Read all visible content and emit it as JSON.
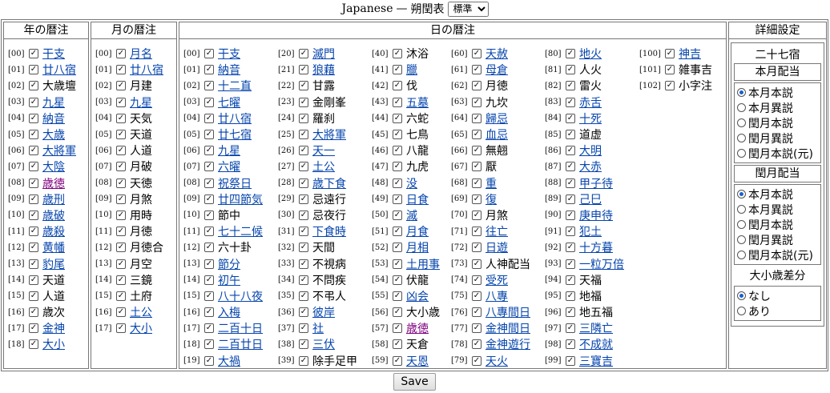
{
  "header": {
    "lang": "Japanese",
    "dash": "—",
    "title": "朔閏表",
    "select_value": "標準"
  },
  "columns": {
    "year": "年の暦注",
    "month": "月の暦注",
    "day": "日の暦注",
    "settings": "詳細設定"
  },
  "year_items": [
    {
      "idx": "[00]",
      "label": "干支",
      "link": true
    },
    {
      "idx": "[01]",
      "label": "廿八宿",
      "link": true
    },
    {
      "idx": "[02]",
      "label": "大歳壇",
      "link": false
    },
    {
      "idx": "[03]",
      "label": "九星",
      "link": true
    },
    {
      "idx": "[04]",
      "label": "納音",
      "link": true
    },
    {
      "idx": "[05]",
      "label": "大歳",
      "link": true
    },
    {
      "idx": "[06]",
      "label": "大將軍",
      "link": true
    },
    {
      "idx": "[07]",
      "label": "大陰",
      "link": true
    },
    {
      "idx": "[08]",
      "label": "歳徳",
      "link": true,
      "visited": true
    },
    {
      "idx": "[09]",
      "label": "歳刑",
      "link": true
    },
    {
      "idx": "[10]",
      "label": "歳破",
      "link": true
    },
    {
      "idx": "[11]",
      "label": "歳殺",
      "link": true
    },
    {
      "idx": "[12]",
      "label": "黄幡",
      "link": true
    },
    {
      "idx": "[13]",
      "label": "豹尾",
      "link": true
    },
    {
      "idx": "[14]",
      "label": "天道",
      "link": false
    },
    {
      "idx": "[15]",
      "label": "人道",
      "link": false
    },
    {
      "idx": "[16]",
      "label": "歳次",
      "link": false
    },
    {
      "idx": "[17]",
      "label": "金神",
      "link": true
    },
    {
      "idx": "[18]",
      "label": "大小",
      "link": true
    }
  ],
  "month_items": [
    {
      "idx": "[00]",
      "label": "月名",
      "link": true
    },
    {
      "idx": "[01]",
      "label": "廿八宿",
      "link": true
    },
    {
      "idx": "[02]",
      "label": "月建",
      "link": false
    },
    {
      "idx": "[03]",
      "label": "九星",
      "link": true
    },
    {
      "idx": "[04]",
      "label": "天気",
      "link": false
    },
    {
      "idx": "[05]",
      "label": "天道",
      "link": false
    },
    {
      "idx": "[06]",
      "label": "人道",
      "link": false
    },
    {
      "idx": "[07]",
      "label": "月破",
      "link": false
    },
    {
      "idx": "[08]",
      "label": "天徳",
      "link": false
    },
    {
      "idx": "[09]",
      "label": "月煞",
      "link": false
    },
    {
      "idx": "[10]",
      "label": "用時",
      "link": false
    },
    {
      "idx": "[11]",
      "label": "月徳",
      "link": false
    },
    {
      "idx": "[12]",
      "label": "月徳合",
      "link": false
    },
    {
      "idx": "[13]",
      "label": "月空",
      "link": false
    },
    {
      "idx": "[14]",
      "label": "三鏡",
      "link": false
    },
    {
      "idx": "[15]",
      "label": "土府",
      "link": false
    },
    {
      "idx": "[16]",
      "label": "土公",
      "link": true
    },
    {
      "idx": "[17]",
      "label": "大小",
      "link": true
    }
  ],
  "day_columns": [
    [
      {
        "idx": "[00]",
        "label": "干支",
        "link": true
      },
      {
        "idx": "[01]",
        "label": "納音",
        "link": true
      },
      {
        "idx": "[02]",
        "label": "十二直",
        "link": true
      },
      {
        "idx": "[03]",
        "label": "七曜",
        "link": true
      },
      {
        "idx": "[04]",
        "label": "廿八宿",
        "link": true
      },
      {
        "idx": "[05]",
        "label": "廿七宿",
        "link": true
      },
      {
        "idx": "[06]",
        "label": "九星",
        "link": true
      },
      {
        "idx": "[07]",
        "label": "六曜",
        "link": true
      },
      {
        "idx": "[08]",
        "label": "祝祭日",
        "link": true
      },
      {
        "idx": "[09]",
        "label": "廿四節気",
        "link": true
      },
      {
        "idx": "[10]",
        "label": "節中",
        "link": false
      },
      {
        "idx": "[11]",
        "label": "七十二候",
        "link": true
      },
      {
        "idx": "[12]",
        "label": "六十卦",
        "link": false
      },
      {
        "idx": "[13]",
        "label": "節分",
        "link": true
      },
      {
        "idx": "[14]",
        "label": "初午",
        "link": true
      },
      {
        "idx": "[15]",
        "label": "八十八夜",
        "link": true
      },
      {
        "idx": "[16]",
        "label": "入梅",
        "link": true
      },
      {
        "idx": "[17]",
        "label": "二百十日",
        "link": true
      },
      {
        "idx": "[18]",
        "label": "二百廿日",
        "link": true
      },
      {
        "idx": "[19]",
        "label": "大禍",
        "link": true
      }
    ],
    [
      {
        "idx": "[20]",
        "label": "滅門",
        "link": true
      },
      {
        "idx": "[21]",
        "label": "狼藉",
        "link": true
      },
      {
        "idx": "[22]",
        "label": "甘露",
        "link": false
      },
      {
        "idx": "[23]",
        "label": "金剛峯",
        "link": false
      },
      {
        "idx": "[24]",
        "label": "羅刹",
        "link": false
      },
      {
        "idx": "[25]",
        "label": "大將軍",
        "link": true
      },
      {
        "idx": "[26]",
        "label": "天一",
        "link": true
      },
      {
        "idx": "[27]",
        "label": "土公",
        "link": true
      },
      {
        "idx": "[28]",
        "label": "歳下食",
        "link": true
      },
      {
        "idx": "[29]",
        "label": "忌遠行",
        "link": false
      },
      {
        "idx": "[30]",
        "label": "忌夜行",
        "link": false
      },
      {
        "idx": "[31]",
        "label": "下食時",
        "link": true
      },
      {
        "idx": "[32]",
        "label": "天間",
        "link": false
      },
      {
        "idx": "[33]",
        "label": "不視病",
        "link": false
      },
      {
        "idx": "[34]",
        "label": "不問疾",
        "link": false
      },
      {
        "idx": "[35]",
        "label": "不弔人",
        "link": false
      },
      {
        "idx": "[36]",
        "label": "彼岸",
        "link": true
      },
      {
        "idx": "[37]",
        "label": "社",
        "link": true
      },
      {
        "idx": "[38]",
        "label": "三伏",
        "link": true
      },
      {
        "idx": "[39]",
        "label": "除手足甲",
        "link": false
      }
    ],
    [
      {
        "idx": "[40]",
        "label": "沐浴",
        "link": false
      },
      {
        "idx": "[41]",
        "label": "臘",
        "link": true
      },
      {
        "idx": "[42]",
        "label": "伐",
        "link": false
      },
      {
        "idx": "[43]",
        "label": "五墓",
        "link": true
      },
      {
        "idx": "[44]",
        "label": "六蛇",
        "link": false
      },
      {
        "idx": "[45]",
        "label": "七鳥",
        "link": false
      },
      {
        "idx": "[46]",
        "label": "八龍",
        "link": false
      },
      {
        "idx": "[47]",
        "label": "九虎",
        "link": false
      },
      {
        "idx": "[48]",
        "label": "没",
        "link": true
      },
      {
        "idx": "[49]",
        "label": "日食",
        "link": true
      },
      {
        "idx": "[50]",
        "label": "滅",
        "link": true
      },
      {
        "idx": "[51]",
        "label": "月食",
        "link": true
      },
      {
        "idx": "[52]",
        "label": "月相",
        "link": true
      },
      {
        "idx": "[53]",
        "label": "土用事",
        "link": true
      },
      {
        "idx": "[54]",
        "label": "伏龍",
        "link": false
      },
      {
        "idx": "[55]",
        "label": "凶会",
        "link": true
      },
      {
        "idx": "[56]",
        "label": "大小歳",
        "link": false
      },
      {
        "idx": "[57]",
        "label": "歳徳",
        "link": true,
        "visited": true
      },
      {
        "idx": "[58]",
        "label": "天倉",
        "link": false
      },
      {
        "idx": "[59]",
        "label": "天恩",
        "link": true
      }
    ],
    [
      {
        "idx": "[60]",
        "label": "天赦",
        "link": true
      },
      {
        "idx": "[61]",
        "label": "母倉",
        "link": true
      },
      {
        "idx": "[62]",
        "label": "月徳",
        "link": false
      },
      {
        "idx": "[63]",
        "label": "九坎",
        "link": false
      },
      {
        "idx": "[64]",
        "label": "歸忌",
        "link": true
      },
      {
        "idx": "[65]",
        "label": "血忌",
        "link": true
      },
      {
        "idx": "[66]",
        "label": "無翹",
        "link": false
      },
      {
        "idx": "[67]",
        "label": "厭",
        "link": false
      },
      {
        "idx": "[68]",
        "label": "重",
        "link": true
      },
      {
        "idx": "[69]",
        "label": "復",
        "link": true
      },
      {
        "idx": "[70]",
        "label": "月煞",
        "link": false
      },
      {
        "idx": "[71]",
        "label": "往亡",
        "link": true
      },
      {
        "idx": "[72]",
        "label": "日遊",
        "link": true
      },
      {
        "idx": "[73]",
        "label": "人神配当",
        "link": false
      },
      {
        "idx": "[74]",
        "label": "受死",
        "link": true
      },
      {
        "idx": "[75]",
        "label": "八專",
        "link": true
      },
      {
        "idx": "[76]",
        "label": "八專間日",
        "link": true
      },
      {
        "idx": "[77]",
        "label": "金神間日",
        "link": true
      },
      {
        "idx": "[78]",
        "label": "金神遊行",
        "link": true
      },
      {
        "idx": "[79]",
        "label": "天火",
        "link": true
      }
    ],
    [
      {
        "idx": "[80]",
        "label": "地火",
        "link": true
      },
      {
        "idx": "[81]",
        "label": "人火",
        "link": false
      },
      {
        "idx": "[82]",
        "label": "雷火",
        "link": false
      },
      {
        "idx": "[83]",
        "label": "赤舌",
        "link": true
      },
      {
        "idx": "[84]",
        "label": "十死",
        "link": true
      },
      {
        "idx": "[85]",
        "label": "道虚",
        "link": false
      },
      {
        "idx": "[86]",
        "label": "大明",
        "link": true
      },
      {
        "idx": "[87]",
        "label": "大赤",
        "link": true
      },
      {
        "idx": "[88]",
        "label": "甲子待",
        "link": true
      },
      {
        "idx": "[89]",
        "label": "己巳",
        "link": true
      },
      {
        "idx": "[90]",
        "label": "庚申待",
        "link": true
      },
      {
        "idx": "[91]",
        "label": "犯土",
        "link": true
      },
      {
        "idx": "[92]",
        "label": "十方暮",
        "link": true
      },
      {
        "idx": "[93]",
        "label": "一粒万倍",
        "link": true
      },
      {
        "idx": "[94]",
        "label": "天福",
        "link": false
      },
      {
        "idx": "[95]",
        "label": "地福",
        "link": false
      },
      {
        "idx": "[96]",
        "label": "地五福",
        "link": false
      },
      {
        "idx": "[97]",
        "label": "三隣亡",
        "link": true
      },
      {
        "idx": "[98]",
        "label": "不成就",
        "link": true
      },
      {
        "idx": "[99]",
        "label": "三寶吉",
        "link": true
      }
    ],
    [
      {
        "idx": "[100]",
        "label": "神吉",
        "link": true
      },
      {
        "idx": "[101]",
        "label": "雑事吉",
        "link": false
      },
      {
        "idx": "[102]",
        "label": "小字注",
        "link": false
      }
    ]
  ],
  "settings": {
    "section1": "二十七宿",
    "section2": "本月配当",
    "radios1": [
      {
        "label": "本月本説",
        "checked": true
      },
      {
        "label": "本月異説",
        "checked": false
      },
      {
        "label": "閏月本説",
        "checked": false
      },
      {
        "label": "閏月異説",
        "checked": false
      },
      {
        "label": "閏月本説(元)",
        "checked": false
      }
    ],
    "section3": "閏月配当",
    "radios2": [
      {
        "label": "本月本説",
        "checked": true
      },
      {
        "label": "本月異説",
        "checked": false
      },
      {
        "label": "閏月本説",
        "checked": false
      },
      {
        "label": "閏月異説",
        "checked": false
      },
      {
        "label": "閏月本説(元)",
        "checked": false
      }
    ],
    "section4": "大小歳差分",
    "radios3": [
      {
        "label": "なし",
        "checked": true
      },
      {
        "label": "あり",
        "checked": false
      }
    ]
  },
  "save_label": "Save"
}
